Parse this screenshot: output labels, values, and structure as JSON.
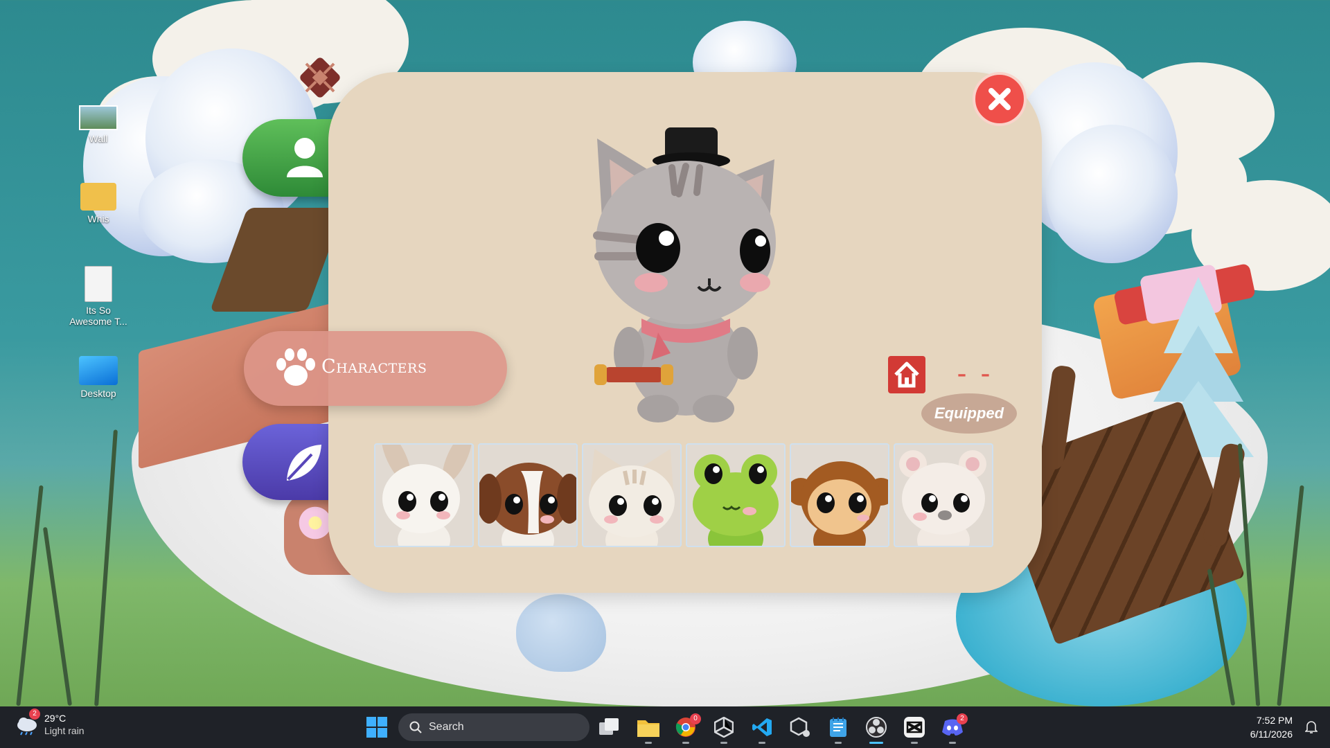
{
  "desktop": {
    "icons": [
      {
        "label": "Wall",
        "icon": "image-file-icon"
      },
      {
        "label": "Whis",
        "icon": "folder-icon"
      },
      {
        "label": "Its So Awesome T...",
        "icon": "text-file-icon"
      },
      {
        "label": "Desktop",
        "icon": "desktop-shortcut-icon"
      }
    ]
  },
  "game": {
    "menu": {
      "profile_icon": "user-icon",
      "characters_label": "Characters",
      "characters_icon": "paw-icon",
      "nature_icon": "leaf-icon"
    },
    "panel": {
      "close_icon": "close-icon",
      "home_icon": "house-icon",
      "status_dash": "– –",
      "equipped_label": "Equipped",
      "selected_character": "gray tabby cat with top hat",
      "characters": [
        {
          "name": "bunny",
          "icon": "bunny-icon"
        },
        {
          "name": "puppy",
          "icon": "puppy-icon"
        },
        {
          "name": "cat",
          "icon": "cat-icon"
        },
        {
          "name": "frog",
          "icon": "frog-icon"
        },
        {
          "name": "monkey",
          "icon": "monkey-icon"
        },
        {
          "name": "bear",
          "icon": "bear-icon"
        }
      ]
    }
  },
  "taskbar": {
    "weather": {
      "badge": "2",
      "temp": "29°C",
      "condition": "Light rain"
    },
    "search_placeholder": "Search",
    "apps": [
      {
        "name": "start",
        "icon": "windows-start-icon"
      },
      {
        "name": "task-view",
        "icon": "task-view-icon"
      },
      {
        "name": "file-explorer",
        "icon": "folder-icon"
      },
      {
        "name": "chrome",
        "icon": "chrome-icon",
        "badge": "0"
      },
      {
        "name": "unity",
        "icon": "unity-icon"
      },
      {
        "name": "vscode",
        "icon": "vscode-icon"
      },
      {
        "name": "unity-hub",
        "icon": "unity-hub-icon"
      },
      {
        "name": "notepad",
        "icon": "notepad-icon"
      },
      {
        "name": "obs",
        "icon": "obs-icon"
      },
      {
        "name": "capcut",
        "icon": "capcut-icon"
      },
      {
        "name": "discord",
        "icon": "discord-icon",
        "badge": "2"
      }
    ],
    "time": "7:52 PM",
    "date": "6/11/2026"
  },
  "colors": {
    "panel": "#e6d6bf",
    "accent_red": "#ef4f4a",
    "characters_button": "#dd9689",
    "equipped_tag": "#c7a895"
  }
}
